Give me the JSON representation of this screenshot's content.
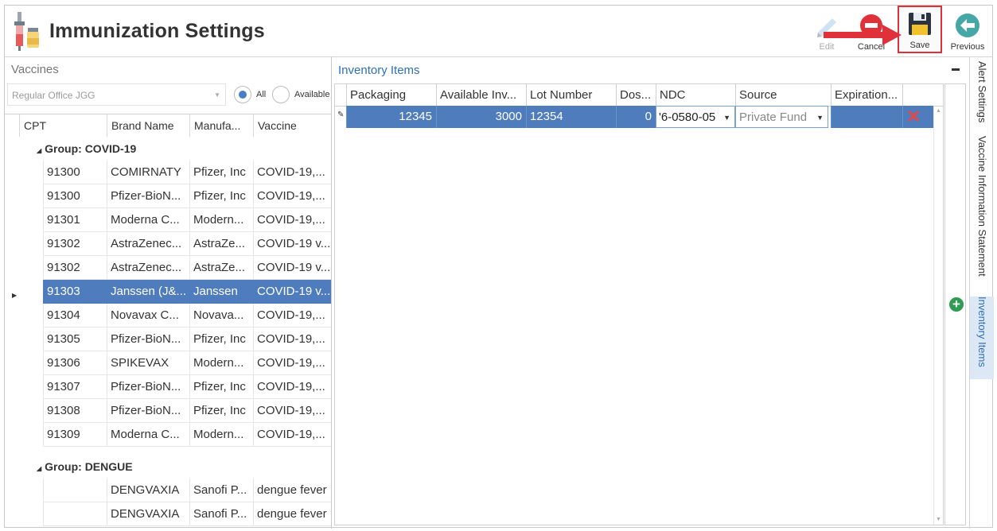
{
  "app": {
    "title": "Immunization Settings"
  },
  "toolbar": {
    "edit_label": "Edit",
    "cancel_label": "Cancel",
    "save_label": "Save",
    "previous_label": "Previous"
  },
  "vaccines": {
    "title": "Vaccines",
    "office_dropdown": "Regular Office JGG",
    "filter_all": "All",
    "filter_available": "Available",
    "columns": [
      "CPT",
      "Brand Name",
      "Manufa...",
      "Vaccine"
    ],
    "groups": [
      {
        "label": "Group: COVID-19",
        "rows": [
          {
            "cpt": "91300",
            "brand": "COMIRNATY",
            "manufacturer": "Pfizer, Inc",
            "vaccine": "COVID-19,..."
          },
          {
            "cpt": "91300",
            "brand": "Pfizer-BioN...",
            "manufacturer": "Pfizer, Inc",
            "vaccine": "COVID-19,..."
          },
          {
            "cpt": "91301",
            "brand": "Moderna C...",
            "manufacturer": "Modern...",
            "vaccine": "COVID-19,..."
          },
          {
            "cpt": "91302",
            "brand": "AstraZenec...",
            "manufacturer": "AstraZe...",
            "vaccine": "COVID-19 v..."
          },
          {
            "cpt": "91302",
            "brand": "AstraZenec...",
            "manufacturer": "AstraZe...",
            "vaccine": "COVID-19 v..."
          },
          {
            "cpt": "91303",
            "brand": "Janssen (J&...",
            "manufacturer": "Janssen",
            "vaccine": "COVID-19 v...",
            "selected": true
          },
          {
            "cpt": "91304",
            "brand": "Novavax C...",
            "manufacturer": "Novava...",
            "vaccine": "COVID-19,..."
          },
          {
            "cpt": "91305",
            "brand": "Pfizer-BioN...",
            "manufacturer": "Pfizer, Inc",
            "vaccine": "COVID-19,..."
          },
          {
            "cpt": "91306",
            "brand": "SPIKEVAX",
            "manufacturer": "Modern...",
            "vaccine": "COVID-19,..."
          },
          {
            "cpt": "91307",
            "brand": "Pfizer-BioN...",
            "manufacturer": "Pfizer, Inc",
            "vaccine": "COVID-19,..."
          },
          {
            "cpt": "91308",
            "brand": "Pfizer-BioN...",
            "manufacturer": "Pfizer, Inc",
            "vaccine": "COVID-19,..."
          },
          {
            "cpt": "91309",
            "brand": "Moderna C...",
            "manufacturer": "Modern...",
            "vaccine": "COVID-19,..."
          }
        ]
      },
      {
        "label": "Group: DENGUE",
        "rows": [
          {
            "cpt": "",
            "brand": "DENGVAXIA",
            "manufacturer": "Sanofi P...",
            "vaccine": "dengue fever"
          },
          {
            "cpt": "",
            "brand": "DENGVAXIA",
            "manufacturer": "Sanofi P...",
            "vaccine": "dengue fever"
          }
        ]
      }
    ]
  },
  "inventory": {
    "title": "Inventory Items",
    "columns": [
      "Packaging",
      "Available Inv...",
      "Lot Number",
      "Dos...",
      "NDC",
      "Source",
      "Expiration..."
    ],
    "row": {
      "packaging": "12345",
      "available": "3000",
      "lot": "12354",
      "dose": "0",
      "ndc": "'6-0580-05",
      "source": "Private Fund",
      "expiration": ""
    }
  },
  "side_tabs": {
    "alert": "Alert Settings",
    "vis": "Vaccine Information Statement",
    "inventory": "Inventory Items"
  },
  "colors": {
    "selection": "#4e7cbc",
    "accent": "#2f6fb4",
    "highlight_border": "#e0313a"
  }
}
